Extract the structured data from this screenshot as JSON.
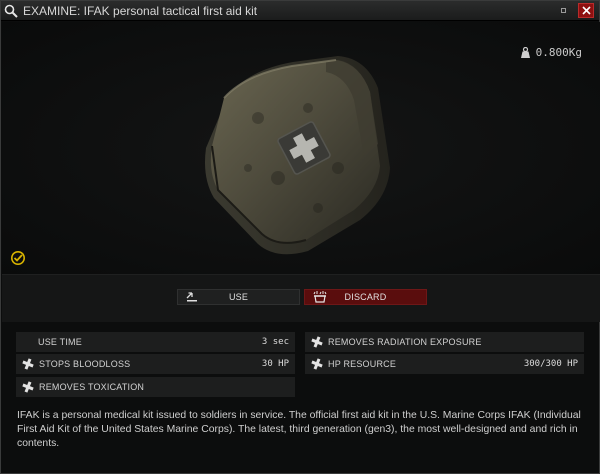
{
  "window": {
    "title": "EXAMINE: IFAK personal tactical first aid kit",
    "weight": "0.800Kg",
    "icons": {
      "title": "magnifier-icon",
      "weight": "weight-icon",
      "examined": "checkmark-badge-icon",
      "minimize": "minimize-icon",
      "close": "close-icon"
    }
  },
  "actions": {
    "use_label": "USE",
    "discard_label": "DISCARD",
    "use_icon": "hand-use-icon",
    "discard_icon": "trash-icon"
  },
  "stats": {
    "use_time": {
      "label": "USE TIME",
      "value": "3 sec"
    },
    "removes_radiation": {
      "label": "REMOVES RADIATION EXPOSURE",
      "icon": "medical-cross-icon"
    },
    "stops_bloodloss": {
      "label": "STOPS BLOODLOSS",
      "value": "30 HP",
      "icon": "medical-cross-icon"
    },
    "hp_resource": {
      "label": "HP RESOURCE",
      "value": "300/300 HP",
      "icon": "medical-cross-icon"
    },
    "removes_toxication": {
      "label": "REMOVES TOXICATION",
      "icon": "medical-cross-icon"
    }
  },
  "description": "IFAK is a personal medical kit issued to soldiers in service. The official first aid kit in the U.S. Marine Corps IFAK (Individual First Aid Kit of the United States Marine Corps). The latest, third generation (gen3), the most well-designed and and rich in contents.",
  "colors": {
    "discard": "#5a0d0d",
    "close": "#8e1010",
    "examined": "#d8b400"
  }
}
